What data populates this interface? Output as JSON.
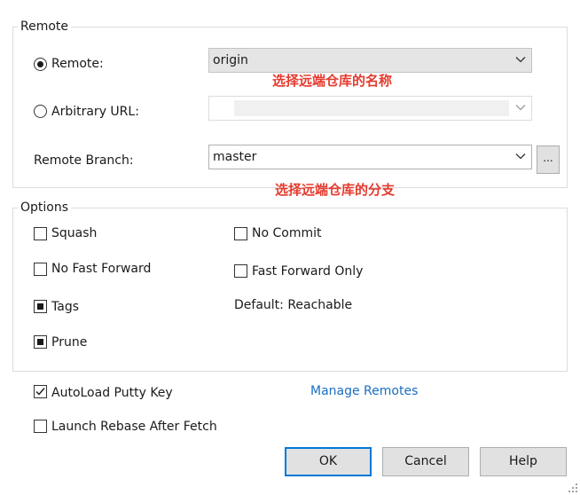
{
  "remote_group": {
    "title": "Remote",
    "remote_radio_label": "Remote:",
    "remote_value": "origin",
    "arbitrary_url_label": "Arbitrary URL:",
    "arbitrary_url_value": "",
    "remote_branch_label": "Remote Branch:",
    "remote_branch_value": "master",
    "browse_button_label": "...",
    "annotation_remote": "选择远端仓库的名称",
    "annotation_branch": "选择远端仓库的分支"
  },
  "options_group": {
    "title": "Options",
    "squash_label": "Squash",
    "no_commit_label": "No Commit",
    "no_fast_forward_label": "No Fast Forward",
    "fast_forward_only_label": "Fast Forward Only",
    "tags_label": "Tags",
    "tags_default_text": "Default: Reachable",
    "prune_label": "Prune"
  },
  "footer": {
    "autoload_putty_key_label": "AutoLoad Putty Key",
    "manage_remotes_link": "Manage Remotes",
    "launch_rebase_label": "Launch Rebase After Fetch",
    "ok_label": "OK",
    "cancel_label": "Cancel",
    "help_label": "Help"
  },
  "colors": {
    "annotation": "#e53a2e",
    "link": "#1a6fc2",
    "default_button_border": "#0078d7"
  },
  "icons": {
    "dropdown": "chevron-down-icon",
    "check": "checkmark-icon",
    "grip": "resize-grip-icon"
  }
}
